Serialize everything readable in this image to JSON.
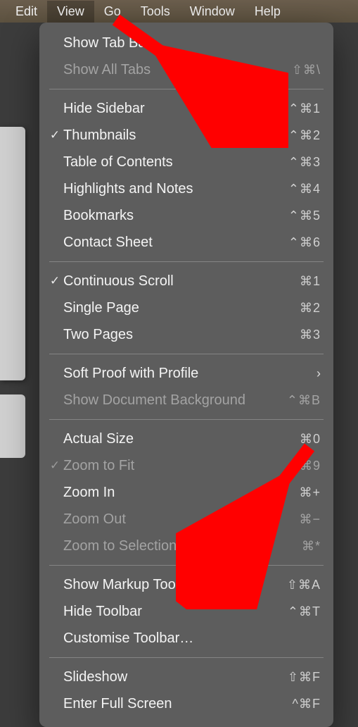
{
  "menubar": {
    "items": [
      {
        "label": "Edit"
      },
      {
        "label": "View",
        "active": true
      },
      {
        "label": "Go"
      },
      {
        "label": "Tools"
      },
      {
        "label": "Window"
      },
      {
        "label": "Help"
      }
    ]
  },
  "menu": {
    "groups": [
      [
        {
          "label": "Show Tab Bar",
          "shortcut": "",
          "disabled": false,
          "checked": false
        },
        {
          "label": "Show All Tabs",
          "shortcut": "⇧⌘\\",
          "disabled": true,
          "checked": false
        }
      ],
      [
        {
          "label": "Hide Sidebar",
          "shortcut": "⌃⌘1",
          "disabled": false,
          "checked": false
        },
        {
          "label": "Thumbnails",
          "shortcut": "⌃⌘2",
          "disabled": false,
          "checked": true
        },
        {
          "label": "Table of Contents",
          "shortcut": "⌃⌘3",
          "disabled": false,
          "checked": false
        },
        {
          "label": "Highlights and Notes",
          "shortcut": "⌃⌘4",
          "disabled": false,
          "checked": false
        },
        {
          "label": "Bookmarks",
          "shortcut": "⌃⌘5",
          "disabled": false,
          "checked": false
        },
        {
          "label": "Contact Sheet",
          "shortcut": "⌃⌘6",
          "disabled": false,
          "checked": false
        }
      ],
      [
        {
          "label": "Continuous Scroll",
          "shortcut": "⌘1",
          "disabled": false,
          "checked": true
        },
        {
          "label": "Single Page",
          "shortcut": "⌘2",
          "disabled": false,
          "checked": false
        },
        {
          "label": "Two Pages",
          "shortcut": "⌘3",
          "disabled": false,
          "checked": false
        }
      ],
      [
        {
          "label": "Soft Proof with Profile",
          "shortcut": "",
          "disabled": false,
          "checked": false,
          "submenu": true
        },
        {
          "label": "Show Document Background",
          "shortcut": "⌃⌘B",
          "disabled": true,
          "checked": false
        }
      ],
      [
        {
          "label": "Actual Size",
          "shortcut": "⌘0",
          "disabled": false,
          "checked": false
        },
        {
          "label": "Zoom to Fit",
          "shortcut": "⌘9",
          "disabled": true,
          "checked": true
        },
        {
          "label": "Zoom In",
          "shortcut": "⌘+",
          "disabled": false,
          "checked": false
        },
        {
          "label": "Zoom Out",
          "shortcut": "⌘−",
          "disabled": true,
          "checked": false
        },
        {
          "label": "Zoom to Selection",
          "shortcut": "⌘*",
          "disabled": true,
          "checked": false
        }
      ],
      [
        {
          "label": "Show Markup Toolbar",
          "shortcut": "⇧⌘A",
          "disabled": false,
          "checked": false
        },
        {
          "label": "Hide Toolbar",
          "shortcut": "⌃⌘T",
          "disabled": false,
          "checked": false
        },
        {
          "label": "Customise Toolbar…",
          "shortcut": "",
          "disabled": false,
          "checked": false
        }
      ],
      [
        {
          "label": "Slideshow",
          "shortcut": "⇧⌘F",
          "disabled": false,
          "checked": false
        },
        {
          "label": "Enter Full Screen",
          "shortcut": "^⌘F",
          "disabled": false,
          "checked": false
        }
      ]
    ]
  },
  "annotations": {
    "arrow1_target": "View menu",
    "arrow2_target": "Show Markup Toolbar"
  }
}
